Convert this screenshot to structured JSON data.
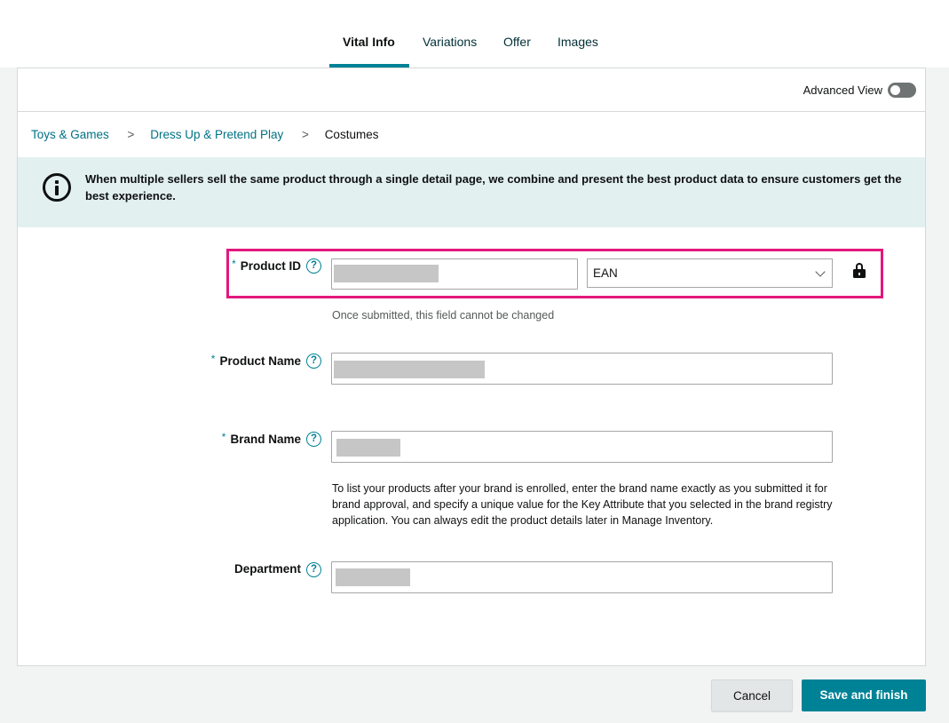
{
  "tabs": [
    {
      "label": "Vital Info",
      "active": true
    },
    {
      "label": "Variations",
      "active": false
    },
    {
      "label": "Offer",
      "active": false
    },
    {
      "label": "Images",
      "active": false
    }
  ],
  "advanced_view": {
    "label": "Advanced View",
    "enabled": false
  },
  "breadcrumb": {
    "items": [
      "Toys & Games",
      "Dress Up & Pretend Play",
      "Costumes"
    ],
    "separator": ">"
  },
  "banner": {
    "text": "When multiple sellers sell the same product through a single detail page, we combine and present the best product data to ensure customers get the best experience."
  },
  "required_marker": "*",
  "help_glyph": "?",
  "fields": {
    "product_id": {
      "label": "Product ID",
      "required": true,
      "value_redacted": true,
      "id_type": "EAN",
      "hint": "Once submitted, this field cannot be changed"
    },
    "product_name": {
      "label": "Product Name",
      "required": true,
      "value_redacted": true
    },
    "brand_name": {
      "label": "Brand Name",
      "required": true,
      "value_redacted": true,
      "note": "To list your products after your brand is enrolled, enter the brand name exactly as you submitted it for brand approval, and specify a unique value for the Key Attribute that you selected in the brand registry application. You can always edit the product details later in Manage Inventory."
    },
    "department": {
      "label": "Department",
      "required": false,
      "value_redacted": true
    }
  },
  "buttons": {
    "cancel": "Cancel",
    "save": "Save and finish"
  },
  "colors": {
    "accent": "#008296",
    "highlight_border": "#e3177c",
    "banner_bg": "#e3f0f0",
    "link": "#007185"
  },
  "icons": [
    "info-icon",
    "help-icon",
    "chevron-down-icon",
    "lock-icon",
    "chevron-right-icon"
  ]
}
